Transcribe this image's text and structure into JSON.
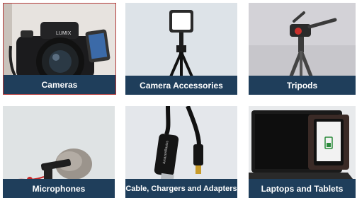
{
  "tiles": [
    {
      "label": "Cameras",
      "icon": "camera-icon"
    },
    {
      "label": "Camera Accessories",
      "icon": "light-tripod-icon"
    },
    {
      "label": "Tripods",
      "icon": "tripod-icon"
    },
    {
      "label": "Microphones",
      "icon": "microphone-icon"
    },
    {
      "label": "Cable, Chargers and Adapters",
      "icon": "hdmi-cable-icon"
    },
    {
      "label": "Laptops and Tablets",
      "icon": "laptop-tablet-icon"
    }
  ],
  "camera_brand": "LUMIX",
  "cable_brand": "AmazonBasics",
  "colors": {
    "label_bg": "#1f3e5b",
    "selected_border": "#b33a3a"
  }
}
